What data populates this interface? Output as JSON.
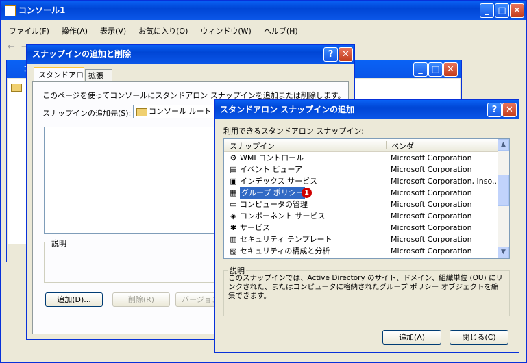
{
  "console": {
    "title": "コンソール1",
    "menu": [
      "ファイル(F)",
      "操作(A)",
      "表示(V)",
      "お気に入り(O)",
      "ウィンドウ(W)",
      "ヘルプ(H)"
    ],
    "inner_title": "コ"
  },
  "add_remove": {
    "title": "スナップインの追加と削除",
    "tabs": [
      "スタンドアロン",
      "拡張"
    ],
    "intro": "このページを使ってコンソールにスタンドアロン スナップインを追加または削除します。",
    "target_label": "スナップインの追加先(S):",
    "target_value": "コンソール ルート",
    "desc_label": "説明",
    "buttons": [
      "追加(D)...",
      "削除(R)",
      "バージョン情"
    ]
  },
  "standalone": {
    "title": "スタンドアロン スナップインの追加",
    "list_label": "利用できるスタンドアロン スナップイン:",
    "col_snapin": "スナップイン",
    "col_vendor": "ベンダ",
    "rows": [
      {
        "name": "WMI コントロール",
        "vendor": "Microsoft Corporation",
        "icon": "wmi-icon"
      },
      {
        "name": "イベント ビューア",
        "vendor": "Microsoft Corporation",
        "icon": "event-viewer-icon"
      },
      {
        "name": "インデックス サービス",
        "vendor": "Microsoft Corporation, Inso...",
        "icon": "index-service-icon"
      },
      {
        "name": "グループ ポリシー",
        "vendor": "Microsoft Corporation",
        "icon": "group-policy-icon",
        "selected": true
      },
      {
        "name": "コンピュータの管理",
        "vendor": "Microsoft Corporation",
        "icon": "computer-management-icon"
      },
      {
        "name": "コンポーネント サービス",
        "vendor": "Microsoft Corporation",
        "icon": "component-services-icon"
      },
      {
        "name": "サービス",
        "vendor": "Microsoft Corporation",
        "icon": "services-icon"
      },
      {
        "name": "セキュリティ テンプレート",
        "vendor": "Microsoft Corporation",
        "icon": "security-template-icon"
      },
      {
        "name": "セキュリティの構成と分析",
        "vendor": "Microsoft Corporation",
        "icon": "security-config-icon"
      }
    ],
    "marker": "1",
    "desc_label": "説明",
    "desc_text": "このスナップインでは、Active Directory のサイト、ドメイン、組織単位 (OU) にリンクされた、またはコンピュータに格納されたグループ ポリシー オブジェクトを編集できます。",
    "add_button": "追加(A)",
    "close_button": "閉じる(C)"
  }
}
